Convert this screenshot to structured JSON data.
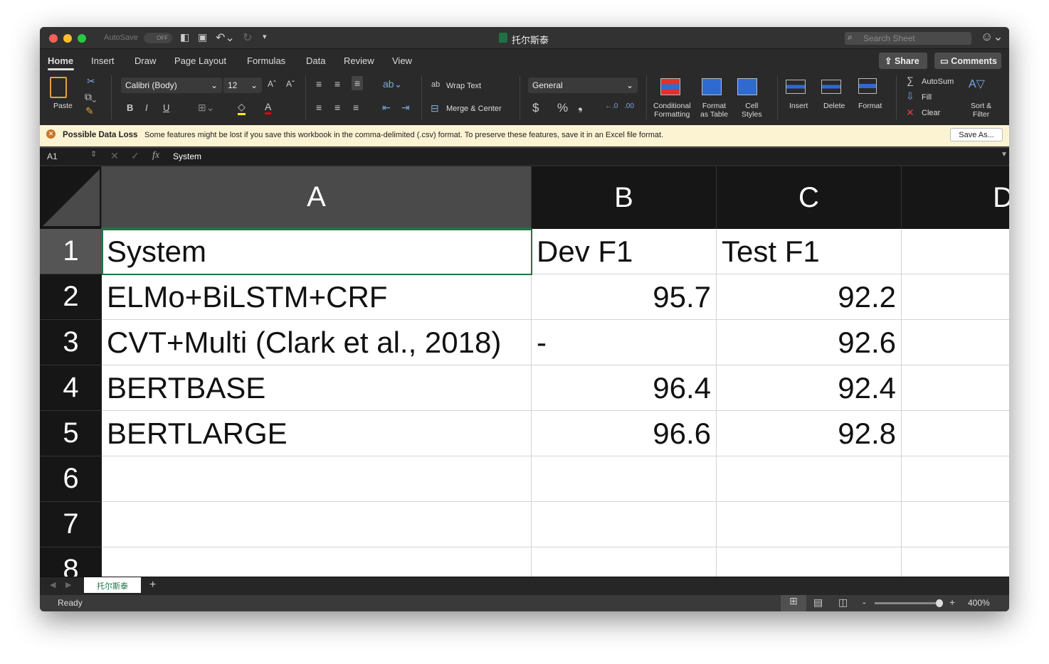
{
  "titlebar": {
    "autosave_label": "AutoSave",
    "autosave_state": "OFF",
    "title": "托尔斯泰",
    "search_placeholder": "Search Sheet"
  },
  "tabs": [
    "Home",
    "Insert",
    "Draw",
    "Page Layout",
    "Formulas",
    "Data",
    "Review",
    "View"
  ],
  "actions": {
    "share": "Share",
    "comments": "Comments"
  },
  "ribbon": {
    "paste": "Paste",
    "font": "Calibri (Body)",
    "size": "12",
    "bold": "B",
    "italic": "I",
    "underline": "U",
    "wrap": "Wrap Text",
    "merge": "Merge & Center",
    "format": "General",
    "dollar": "$",
    "percent": "%",
    "comma": "❟",
    "cond1": "Conditional",
    "cond2": "Formatting",
    "fat1": "Format",
    "fat2": "as Table",
    "cs1": "Cell",
    "cs2": "Styles",
    "insert": "Insert",
    "delete": "Delete",
    "formatc": "Format",
    "autosum": "AutoSum",
    "fill": "Fill",
    "clear": "Clear",
    "sort1": "Sort &",
    "sort2": "Filter"
  },
  "message": {
    "title": "Possible Data Loss",
    "text": "Some features might be lost if you save this workbook in the comma-delimited (.csv) format. To preserve these features, save it in an Excel file format.",
    "button": "Save As..."
  },
  "formula": {
    "cell_ref": "A1",
    "fx": "fx",
    "value": "System"
  },
  "columns": [
    "A",
    "B",
    "C",
    "D"
  ],
  "rows": [
    "1",
    "2",
    "3",
    "4",
    "5",
    "6",
    "7",
    "8"
  ],
  "cells": [
    [
      "System",
      "Dev F1",
      "Test F1"
    ],
    [
      "ELMo+BiLSTM+CRF",
      "95.7",
      "92.2"
    ],
    [
      "CVT+Multi (Clark et al., 2018)",
      "-",
      "92.6"
    ],
    [
      "BERTBASE",
      "96.4",
      "92.4"
    ],
    [
      "BERTLARGE",
      "96.6",
      "92.8"
    ]
  ],
  "sheet_tab": "托尔斯泰",
  "status": {
    "text": "Ready",
    "zoom": "400%",
    "zoom_level": 400
  },
  "colors": {
    "accent": "#1e7145",
    "selection": "#217346"
  }
}
